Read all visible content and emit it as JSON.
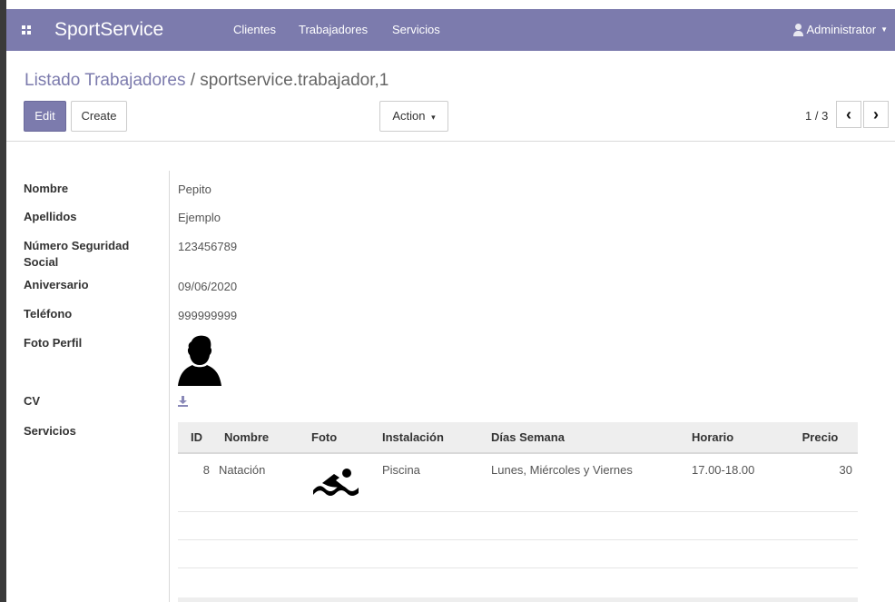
{
  "navbar": {
    "brand": "SportService",
    "menu": [
      "Clientes",
      "Trabajadores",
      "Servicios"
    ],
    "user": "Administrator",
    "colors": {
      "primary": "#7c7bad"
    }
  },
  "breadcrumb": {
    "parent": "Listado Trabajadores",
    "separator": " / ",
    "current": "sportservice.trabajador,1"
  },
  "buttons": {
    "edit": "Edit",
    "create": "Create",
    "action": "Action",
    "action_caret": "▾"
  },
  "pager": {
    "value": "1 / 3",
    "prev": "‹",
    "next": "›"
  },
  "form": {
    "labels": {
      "nombre": "Nombre",
      "apellidos": "Apellidos",
      "nss": "Número Seguridad Social",
      "aniversario": "Aniversario",
      "telefono": "Teléfono",
      "foto": "Foto Perfil",
      "cv": "CV",
      "servicios": "Servicios"
    },
    "values": {
      "nombre": "Pepito",
      "apellidos": "Ejemplo",
      "nss": "123456789",
      "aniversario": "09/06/2020",
      "telefono": "999999999"
    },
    "icons": {
      "foto": "person-silhouette-icon",
      "cv": "download-icon"
    }
  },
  "servicios_table": {
    "columns": [
      "ID",
      "Nombre",
      "Foto",
      "Instalación",
      "Días Semana",
      "Horario",
      "Precio"
    ],
    "rows": [
      {
        "id": "8",
        "nombre": "Natación",
        "foto_icon": "swimmer-icon",
        "instalacion": "Piscina",
        "dias": "Lunes, Miércoles y Viernes",
        "horario": "17.00-18.00",
        "precio": "30"
      }
    ]
  }
}
